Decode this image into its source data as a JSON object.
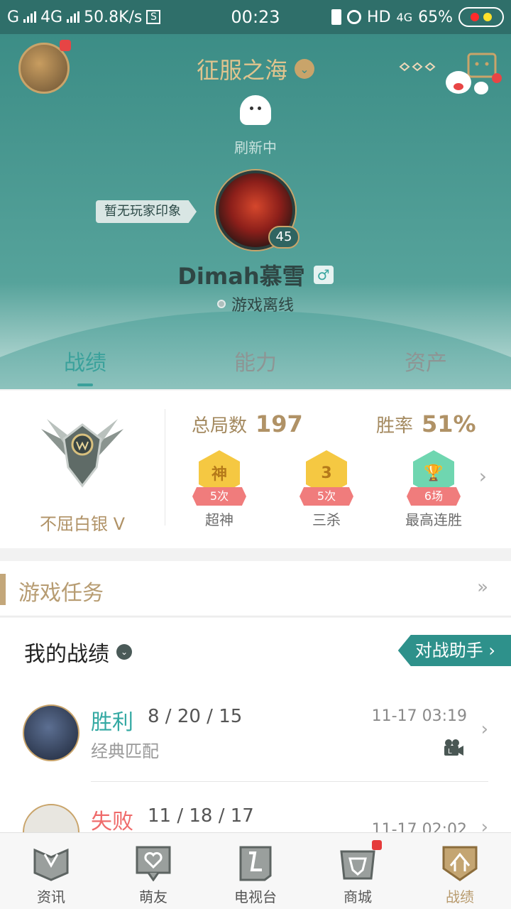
{
  "status_bar": {
    "carrier1": "G",
    "carrier2": "4G",
    "speed": "50.8K/s",
    "time": "00:23",
    "hd": "HD",
    "net": "4G",
    "battery": "65%"
  },
  "header": {
    "server_name": "征服之海",
    "refresh_text": "刷新中",
    "impression_tag": "暂无玩家印象",
    "level": "45",
    "player_name": "Dimah慕雪",
    "gender_icon": "♂",
    "status": "游戏离线"
  },
  "tabs": [
    {
      "label": "战绩",
      "active": true
    },
    {
      "label": "能力",
      "active": false
    },
    {
      "label": "资产",
      "active": false
    }
  ],
  "stats": {
    "rank": "不屈白银 V",
    "total_games_label": "总局数",
    "total_games": "197",
    "win_rate_label": "胜率",
    "win_rate": "51%",
    "achievements": [
      {
        "icon_text": "神",
        "count": "5次",
        "name": "超神",
        "color": "#f5c842"
      },
      {
        "icon_text": "3",
        "count": "5次",
        "name": "三杀",
        "color": "#f5c842"
      },
      {
        "icon_text": "🏆",
        "count": "6场",
        "name": "最高连胜",
        "color": "#6fd6b0"
      }
    ]
  },
  "tasks": {
    "title": "游戏任务"
  },
  "records": {
    "title": "我的战绩",
    "assist_button": "对战助手 ›",
    "matches": [
      {
        "result": "胜利",
        "result_color": "#34a9a3",
        "kda": "8 / 20 / 15",
        "mode": "经典匹配",
        "time": "11-17 03:19"
      },
      {
        "result": "失败",
        "result_color": "#ef6b6b",
        "kda": "11 / 18 / 17",
        "mode": "",
        "time": "11-17 02:02"
      }
    ]
  },
  "bottom_nav": [
    {
      "label": "资讯",
      "icon": "news-icon"
    },
    {
      "label": "萌友",
      "icon": "friends-icon"
    },
    {
      "label": "电视台",
      "icon": "tv-icon"
    },
    {
      "label": "商城",
      "icon": "shop-icon"
    },
    {
      "label": "战绩",
      "icon": "record-icon"
    }
  ]
}
